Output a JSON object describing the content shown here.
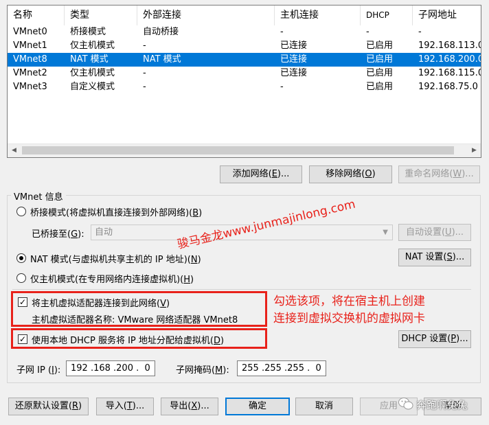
{
  "table": {
    "columns": [
      "名称",
      "类型",
      "外部连接",
      "主机连接",
      "DHCP",
      "子网地址"
    ],
    "rows": [
      {
        "name": "VMnet0",
        "type": "桥接模式",
        "external": "自动桥接",
        "host": "-",
        "dhcp": "-",
        "subnet": "-",
        "selected": false
      },
      {
        "name": "VMnet1",
        "type": "仅主机模式",
        "external": "-",
        "host": "已连接",
        "dhcp": "已启用",
        "subnet": "192.168.113.0",
        "selected": false
      },
      {
        "name": "VMnet8",
        "type": "NAT 模式",
        "external": "NAT 模式",
        "host": "已连接",
        "dhcp": "已启用",
        "subnet": "192.168.200.0",
        "selected": true
      },
      {
        "name": "VMnet2",
        "type": "仅主机模式",
        "external": "-",
        "host": "已连接",
        "dhcp": "已启用",
        "subnet": "192.168.115.0",
        "selected": false
      },
      {
        "name": "VMnet3",
        "type": "自定义模式",
        "external": "-",
        "host": "-",
        "dhcp": "已启用",
        "subnet": "192.168.75.0",
        "selected": false
      }
    ],
    "scroll_left_icon": "triangle-left-icon",
    "scroll_right_icon": "triangle-right-icon"
  },
  "network_buttons": {
    "add": {
      "label": "添加网络(",
      "key": "E",
      "suffix": ")..."
    },
    "remove": {
      "label": "移除网络(",
      "key": "O",
      "suffix": ")"
    },
    "rename": {
      "label": "重命名网络(",
      "key": "W",
      "suffix": ")..."
    }
  },
  "vmnet_info": {
    "group_label": "VMnet 信息",
    "bridged": {
      "label": "桥接模式(将虚拟机直接连接到外部网络)(",
      "key": "B",
      "suffix": ")",
      "selected": false
    },
    "bridged_to": {
      "label": "已桥接至(",
      "key": "G",
      "suffix": "):",
      "value": "自动",
      "auto_button": {
        "label": "自动设置(",
        "key": "U",
        "suffix": ")..."
      }
    },
    "nat": {
      "label": "NAT 模式(与虚拟机共享主机的 IP 地址)(",
      "key": "N",
      "suffix": ")",
      "selected": true,
      "button": {
        "label": "NAT 设置(",
        "key": "S",
        "suffix": ")..."
      }
    },
    "host_only": {
      "label": "仅主机模式(在专用网络内连接虚拟机)(",
      "key": "H",
      "suffix": ")",
      "selected": false
    },
    "connect_adapter": {
      "label": "将主机虚拟适配器连接到此网络(",
      "key": "V",
      "suffix": ")",
      "checked": true
    },
    "adapter_name": "主机虚拟适配器名称: VMware 网络适配器 VMnet8",
    "use_dhcp": {
      "label": "使用本地 DHCP 服务将 IP 地址分配给虚拟机(",
      "key": "D",
      "suffix": ")",
      "checked": true,
      "button": {
        "label": "DHCP 设置(",
        "key": "P",
        "suffix": ")..."
      }
    },
    "subnet_ip": {
      "label": "子网 IP (",
      "key": "I",
      "suffix": "):",
      "value": "192 .168 .200 .  0"
    },
    "subnet_mask": {
      "label": "子网掩码(",
      "key": "M",
      "suffix": "):",
      "value": "255 .255 .255 .  0"
    }
  },
  "annotation": {
    "line1": "勾选该项，将在宿主机上创建",
    "line2": "连接到虚拟交换机的虚拟网卡",
    "watermark": "骏马金龙www.junmajinlong.com",
    "color": "#e8211a"
  },
  "footer": {
    "restore": {
      "label": "还原默认设置(",
      "key": "R",
      "suffix": ")"
    },
    "import": {
      "label": "导入(",
      "key": "T",
      "suffix": ")..."
    },
    "export": {
      "label": "导出(",
      "key": "X",
      "suffix": ")..."
    },
    "ok": "确定",
    "cancel": "取消",
    "apply": "应用",
    "help": "帮助",
    "wechat_icon": "wechat-icon",
    "wechat_name": "奔跑啊兔兔"
  },
  "colors": {
    "selection": "#0078d7",
    "annotation_red": "#e8211a"
  }
}
